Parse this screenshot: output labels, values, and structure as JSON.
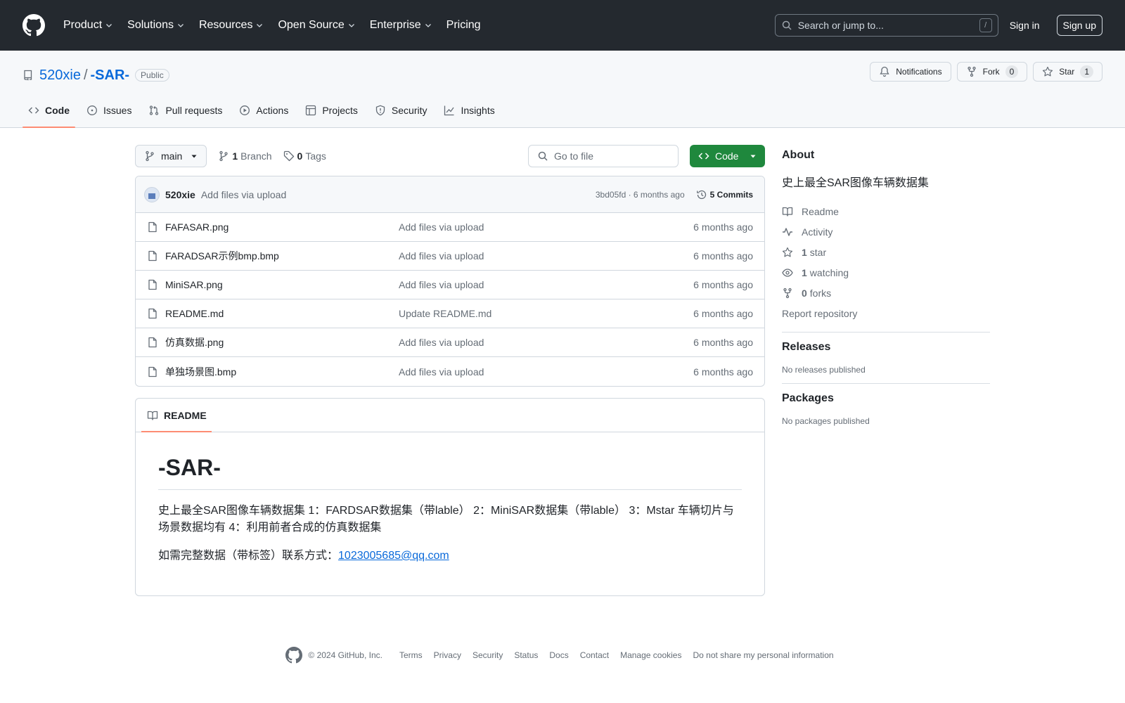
{
  "header": {
    "nav": [
      "Product",
      "Solutions",
      "Resources",
      "Open Source",
      "Enterprise",
      "Pricing"
    ],
    "search_placeholder": "Search or jump to...",
    "search_shortcut": "/",
    "signin": "Sign in",
    "signup": "Sign up"
  },
  "repo": {
    "owner": "520xie",
    "separator": "/",
    "name": "-SAR-",
    "visibility": "Public",
    "notifications": "Notifications",
    "fork_label": "Fork",
    "fork_count": "0",
    "star_label": "Star",
    "star_count": "1"
  },
  "tabs": [
    "Code",
    "Issues",
    "Pull requests",
    "Actions",
    "Projects",
    "Security",
    "Insights"
  ],
  "filenav": {
    "branch": "main",
    "branch_count": "1",
    "branch_label": "Branch",
    "tag_count": "0",
    "tag_label": "Tags",
    "goto_placeholder": "Go to file",
    "code_button": "Code"
  },
  "commit": {
    "author": "520xie",
    "message": "Add files via upload",
    "meta": "3bd05fd · 6 months ago",
    "commits": "5 Commits"
  },
  "files": [
    {
      "name": "FAFASAR.png",
      "message": "Add files via upload",
      "date": "6 months ago"
    },
    {
      "name": "FARADSAR示例bmp.bmp",
      "message": "Add files via upload",
      "date": "6 months ago"
    },
    {
      "name": "MiniSAR.png",
      "message": "Add files via upload",
      "date": "6 months ago"
    },
    {
      "name": "README.md",
      "message": "Update README.md",
      "date": "6 months ago"
    },
    {
      "name": "仿真数据.png",
      "message": "Add files via upload",
      "date": "6 months ago"
    },
    {
      "name": "单独场景图.bmp",
      "message": "Add files via upload",
      "date": "6 months ago"
    }
  ],
  "readme": {
    "tab": "README",
    "title": "-SAR-",
    "paragraph1": "史上最全SAR图像车辆数据集 1：FARDSAR数据集（带lable） 2：MiniSAR数据集（带lable） 3：Mstar 车辆切片与场景数据均有 4：利用前者合成的仿真数据集",
    "paragraph2_prefix": "如需完整数据（带标签）联系方式：",
    "email": "1023005685@qq.com"
  },
  "about": {
    "heading": "About",
    "description": "史上最全SAR图像车辆数据集",
    "readme": "Readme",
    "activity": "Activity",
    "stars_count": "1",
    "stars_label": "star",
    "watching_count": "1",
    "watching_label": "watching",
    "forks_count": "0",
    "forks_label": "forks",
    "report": "Report repository"
  },
  "releases": {
    "heading": "Releases",
    "text": "No releases published"
  },
  "packages": {
    "heading": "Packages",
    "text": "No packages published"
  },
  "footer": {
    "copyright": "© 2024 GitHub, Inc.",
    "links": [
      "Terms",
      "Privacy",
      "Security",
      "Status",
      "Docs",
      "Contact",
      "Manage cookies",
      "Do not share my personal information"
    ]
  }
}
